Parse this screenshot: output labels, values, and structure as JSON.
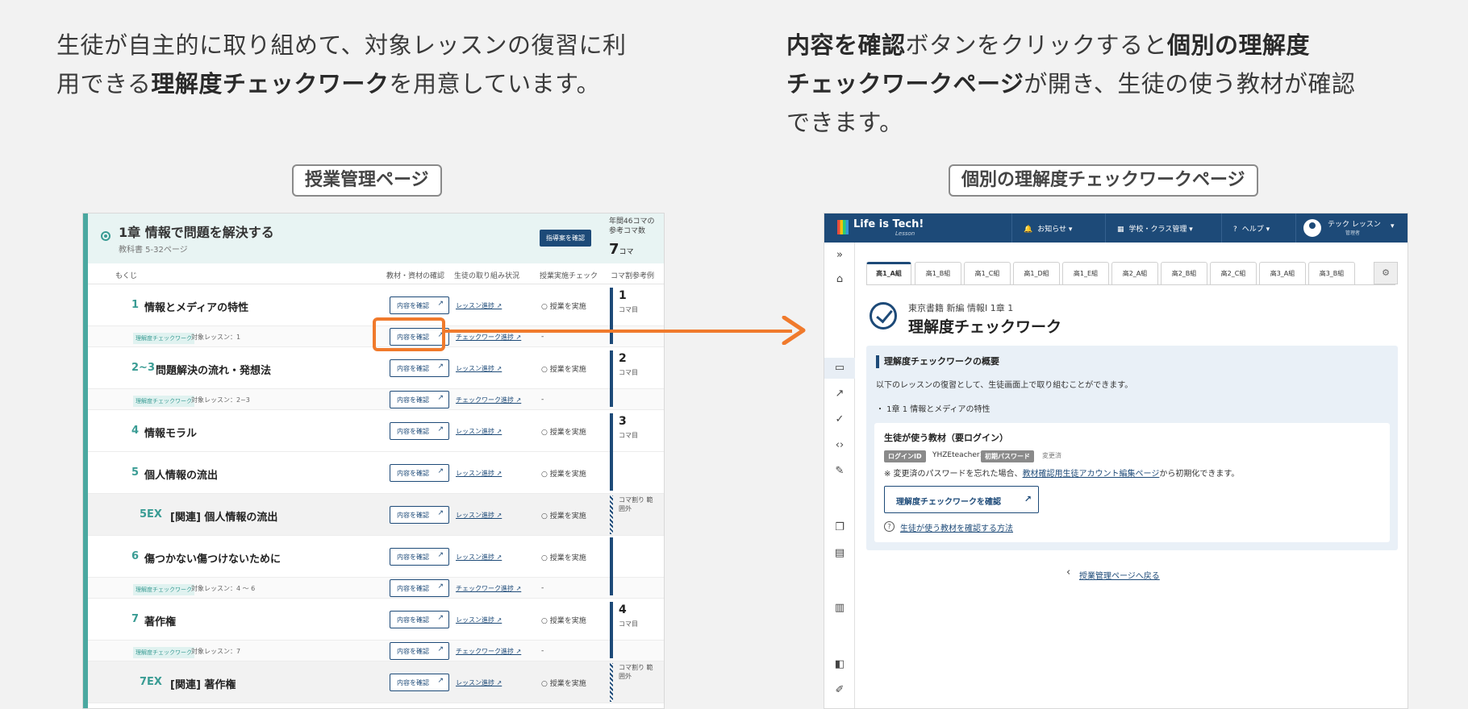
{
  "intro_left": {
    "line1": "生徒が自主的に取り組めて、対象レッスンの復習に利",
    "line2_pre": "用できる",
    "line2_bold": "理解度チェックワーク",
    "line2_post": "を用意しています。"
  },
  "intro_right": {
    "line1_bold_a": "内容を確認",
    "line1_mid": "ボタンをクリックすると",
    "line1_bold_b": "個別の理解度",
    "line2_bold": "チェックワークページ",
    "line2_post": "が開き、生徒の使う教材が確認",
    "line3": "できます。"
  },
  "captions": {
    "left": "授業管理ページ",
    "right": "個別の理解度チェックワークページ"
  },
  "left_screen": {
    "chapter_title": "1章 情報で問題を解決する",
    "chapter_sub": "教科書 5-32ページ",
    "guide_button": "指導案を確認",
    "year_label_1": "年間46コマの",
    "year_label_2": "参考コマ数",
    "year_num": "7",
    "year_unit": "コマ",
    "columns": {
      "toc": "もくじ",
      "material": "教材・資材の確認",
      "status": "生徒の取り組み状況",
      "check": "授業実施チェック",
      "example": "コマ割参考例"
    },
    "check_button": "内容を確認",
    "lesson_progress": "レッスン進捗",
    "work_progress": "チェックワーク進捗",
    "implement": "授業を実施",
    "dash": "-",
    "tag": "理解度チェックワーク",
    "koma_unit": "コマ目",
    "koma_out": "コマ割り 範囲外",
    "lessons": [
      {
        "num": "1",
        "title": "情報とメディアの特性",
        "target": "対象レッスン：1",
        "koma": "1"
      },
      {
        "num": "2~3",
        "title": "問題解決の流れ・発想法",
        "target": "対象レッスン：2~3",
        "koma": "2"
      },
      {
        "num": "4",
        "title": "情報モラル",
        "koma": "3"
      },
      {
        "num": "5",
        "title": "個人情報の流出"
      },
      {
        "num": "5EX",
        "title": "[関連] 個人情報の流出"
      },
      {
        "num": "6",
        "title": "傷つかない傷つけないために",
        "target": "対象レッスン：4 〜 6"
      },
      {
        "num": "7",
        "title": "著作権",
        "target": "対象レッスン：7",
        "koma": "4"
      },
      {
        "num": "7EX",
        "title": "[関連] 著作権"
      }
    ]
  },
  "right_screen": {
    "logo": "Life is Tech!",
    "logo_sub": "Lesson",
    "nav": {
      "news": "お知らせ",
      "school": "学校・クラス管理",
      "help": "ヘルプ",
      "user": "テック レッスン",
      "role": "管理者"
    },
    "tabs": [
      "高1_A組",
      "高1_B組",
      "高1_C組",
      "高1_D組",
      "高1_E組",
      "高2_A組",
      "高2_B組",
      "高2_C組",
      "高3_A組",
      "高3_B組"
    ],
    "subtitle": "東京書籍 新編 情報Ⅰ 1章 1",
    "title": "理解度チェックワーク",
    "panel_heading": "理解度チェックワークの概要",
    "panel_desc": "以下のレッスンの復習として、生徒画面上で取り組むことができます。",
    "panel_bullet": "・ 1章 1 情報とメディアの特性",
    "inner_heading": "生徒が使う教材（要ログイン）",
    "login_id_label": "ログインID",
    "login_id": "YHZEteacher1",
    "init_pw_label": "初期パスワード",
    "changed": "変更済",
    "note_pre": "※ 変更済のパスワードを忘れた場合、",
    "note_link": "教材確認用生徒アカウント編集ページ",
    "note_post": "から初期化できます。",
    "check_work_button": "理解度チェックワークを確認",
    "help_link": "生徒が使う教材を確認する方法",
    "back_link": "授業管理ページへ戻る"
  },
  "colors": {
    "accent_orange": "#f07a2c",
    "navy": "#1d4a78",
    "teal": "#3a9c94"
  }
}
